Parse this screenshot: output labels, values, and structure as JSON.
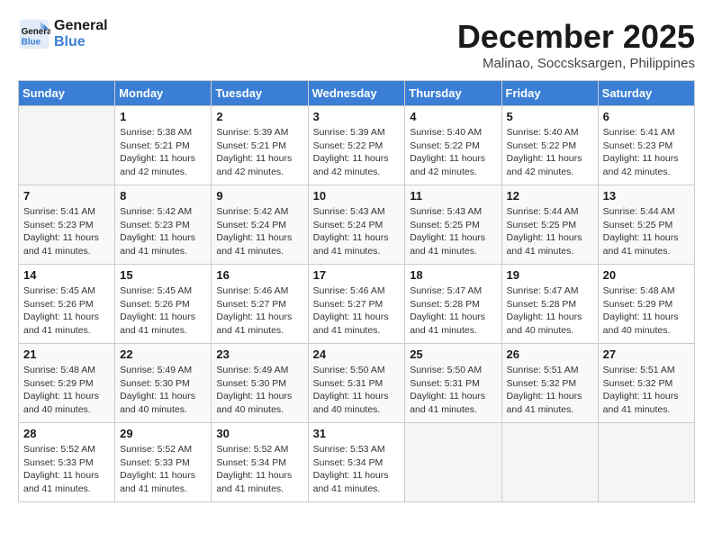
{
  "logo": {
    "line1": "General",
    "line2": "Blue"
  },
  "title": "December 2025",
  "subtitle": "Malinao, Soccsksargen, Philippines",
  "weekdays": [
    "Sunday",
    "Monday",
    "Tuesday",
    "Wednesday",
    "Thursday",
    "Friday",
    "Saturday"
  ],
  "weeks": [
    [
      {
        "day": "",
        "info": ""
      },
      {
        "day": "1",
        "info": "Sunrise: 5:38 AM\nSunset: 5:21 PM\nDaylight: 11 hours and 42 minutes."
      },
      {
        "day": "2",
        "info": "Sunrise: 5:39 AM\nSunset: 5:21 PM\nDaylight: 11 hours and 42 minutes."
      },
      {
        "day": "3",
        "info": "Sunrise: 5:39 AM\nSunset: 5:22 PM\nDaylight: 11 hours and 42 minutes."
      },
      {
        "day": "4",
        "info": "Sunrise: 5:40 AM\nSunset: 5:22 PM\nDaylight: 11 hours and 42 minutes."
      },
      {
        "day": "5",
        "info": "Sunrise: 5:40 AM\nSunset: 5:22 PM\nDaylight: 11 hours and 42 minutes."
      },
      {
        "day": "6",
        "info": "Sunrise: 5:41 AM\nSunset: 5:23 PM\nDaylight: 11 hours and 42 minutes."
      }
    ],
    [
      {
        "day": "7",
        "info": "Sunrise: 5:41 AM\nSunset: 5:23 PM\nDaylight: 11 hours and 41 minutes."
      },
      {
        "day": "8",
        "info": "Sunrise: 5:42 AM\nSunset: 5:23 PM\nDaylight: 11 hours and 41 minutes."
      },
      {
        "day": "9",
        "info": "Sunrise: 5:42 AM\nSunset: 5:24 PM\nDaylight: 11 hours and 41 minutes."
      },
      {
        "day": "10",
        "info": "Sunrise: 5:43 AM\nSunset: 5:24 PM\nDaylight: 11 hours and 41 minutes."
      },
      {
        "day": "11",
        "info": "Sunrise: 5:43 AM\nSunset: 5:25 PM\nDaylight: 11 hours and 41 minutes."
      },
      {
        "day": "12",
        "info": "Sunrise: 5:44 AM\nSunset: 5:25 PM\nDaylight: 11 hours and 41 minutes."
      },
      {
        "day": "13",
        "info": "Sunrise: 5:44 AM\nSunset: 5:25 PM\nDaylight: 11 hours and 41 minutes."
      }
    ],
    [
      {
        "day": "14",
        "info": "Sunrise: 5:45 AM\nSunset: 5:26 PM\nDaylight: 11 hours and 41 minutes."
      },
      {
        "day": "15",
        "info": "Sunrise: 5:45 AM\nSunset: 5:26 PM\nDaylight: 11 hours and 41 minutes."
      },
      {
        "day": "16",
        "info": "Sunrise: 5:46 AM\nSunset: 5:27 PM\nDaylight: 11 hours and 41 minutes."
      },
      {
        "day": "17",
        "info": "Sunrise: 5:46 AM\nSunset: 5:27 PM\nDaylight: 11 hours and 41 minutes."
      },
      {
        "day": "18",
        "info": "Sunrise: 5:47 AM\nSunset: 5:28 PM\nDaylight: 11 hours and 41 minutes."
      },
      {
        "day": "19",
        "info": "Sunrise: 5:47 AM\nSunset: 5:28 PM\nDaylight: 11 hours and 40 minutes."
      },
      {
        "day": "20",
        "info": "Sunrise: 5:48 AM\nSunset: 5:29 PM\nDaylight: 11 hours and 40 minutes."
      }
    ],
    [
      {
        "day": "21",
        "info": "Sunrise: 5:48 AM\nSunset: 5:29 PM\nDaylight: 11 hours and 40 minutes."
      },
      {
        "day": "22",
        "info": "Sunrise: 5:49 AM\nSunset: 5:30 PM\nDaylight: 11 hours and 40 minutes."
      },
      {
        "day": "23",
        "info": "Sunrise: 5:49 AM\nSunset: 5:30 PM\nDaylight: 11 hours and 40 minutes."
      },
      {
        "day": "24",
        "info": "Sunrise: 5:50 AM\nSunset: 5:31 PM\nDaylight: 11 hours and 40 minutes."
      },
      {
        "day": "25",
        "info": "Sunrise: 5:50 AM\nSunset: 5:31 PM\nDaylight: 11 hours and 41 minutes."
      },
      {
        "day": "26",
        "info": "Sunrise: 5:51 AM\nSunset: 5:32 PM\nDaylight: 11 hours and 41 minutes."
      },
      {
        "day": "27",
        "info": "Sunrise: 5:51 AM\nSunset: 5:32 PM\nDaylight: 11 hours and 41 minutes."
      }
    ],
    [
      {
        "day": "28",
        "info": "Sunrise: 5:52 AM\nSunset: 5:33 PM\nDaylight: 11 hours and 41 minutes."
      },
      {
        "day": "29",
        "info": "Sunrise: 5:52 AM\nSunset: 5:33 PM\nDaylight: 11 hours and 41 minutes."
      },
      {
        "day": "30",
        "info": "Sunrise: 5:52 AM\nSunset: 5:34 PM\nDaylight: 11 hours and 41 minutes."
      },
      {
        "day": "31",
        "info": "Sunrise: 5:53 AM\nSunset: 5:34 PM\nDaylight: 11 hours and 41 minutes."
      },
      {
        "day": "",
        "info": ""
      },
      {
        "day": "",
        "info": ""
      },
      {
        "day": "",
        "info": ""
      }
    ]
  ]
}
